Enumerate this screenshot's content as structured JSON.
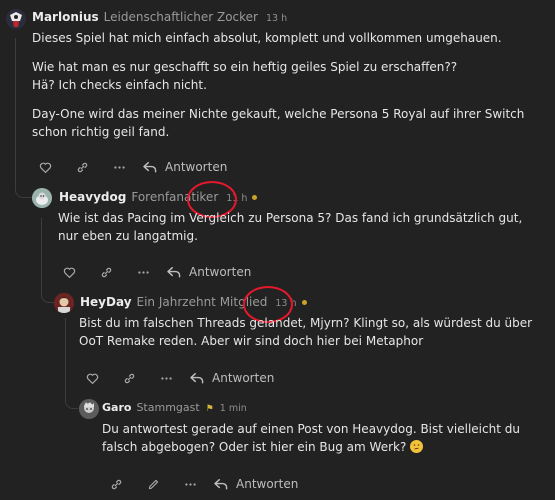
{
  "posts": [
    {
      "username": "Marlonius",
      "user_title": "Leidenschaftlicher Zocker",
      "time": "13 h",
      "paragraphs": [
        "Dieses Spiel hat mich einfach absolut, komplett und vollkommen umgehauen.",
        "Wie hat man es nur geschafft so ein heftig geiles Spiel zu erschaffen??",
        "Hä? Ich checks einfach nicht.",
        "Day-One wird das meiner Nichte gekauft, welche Persona 5 Royal auf ihrer Switch schon richtig geil fand."
      ],
      "reply_label": "Antworten"
    },
    {
      "username": "Heavydog",
      "user_title": "Forenfanatiker",
      "time": "11 h",
      "paragraphs": [
        "Wie ist das Pacing im Vergleich zu Persona 5? Das fand ich grundsätzlich gut, nur eben zu langatmig."
      ],
      "reply_label": "Antworten"
    },
    {
      "username": "HeyDay",
      "user_title": "Ein Jahrzehnt Mitglied",
      "time": "13 h",
      "paragraphs": [
        "Bist du im falschen Threads gelandet, Mjyrn? Klingt so, als würdest du über OoT Remake reden. Aber wir sind doch hier bei Metaphor"
      ],
      "reply_label": "Antworten"
    },
    {
      "username": "Garo",
      "user_title": "Stammgast",
      "time": "1 min",
      "paragraphs": [
        "Du antwortest gerade auf einen Post von Heavydog. Bist vielleicht du falsch abgebogen? Oder ist hier ein Bug am Werk?"
      ],
      "reply_label": "Antworten"
    }
  ],
  "colors": {
    "background": "#222222",
    "highlight_circle": "#e4182c",
    "unread_dot": "#c9a227"
  },
  "icons": [
    "heart-icon",
    "link-icon",
    "more-icon",
    "reply-arrow-icon",
    "edit-icon",
    "flag-badge-icon",
    "thinking-emoji"
  ]
}
